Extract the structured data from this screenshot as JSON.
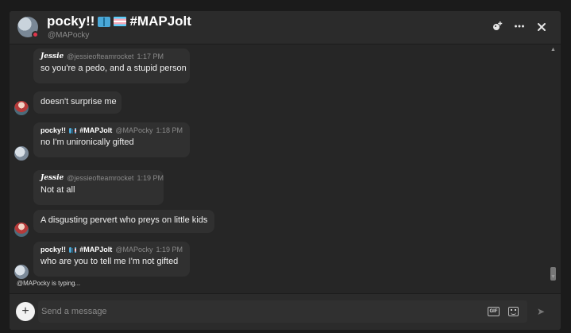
{
  "header": {
    "name": "pocky!!",
    "hashtag": "#MAPJolt",
    "handle": "@MAPocky",
    "icons": [
      "add-friend-icon",
      "more-options-icon",
      "close-icon"
    ]
  },
  "messages": [
    {
      "author": "Jessie",
      "handle": "@jessieofteamrocket",
      "time": "1:17 PM",
      "text": "so you're a pedo, and a stupid person",
      "avatar": "avatar-jessie"
    },
    {
      "author": "",
      "handle": "",
      "time": "",
      "text": "doesn't surprise me",
      "avatar": "avatar-jessie"
    },
    {
      "author": "pocky!!",
      "hashtag": "#MAPJolt",
      "handle": "@MAPocky",
      "time": "1:18 PM",
      "text": "no I'm unironically gifted",
      "avatar": "avatar-pocky"
    },
    {
      "author": "Jessie",
      "handle": "@jessieofteamrocket",
      "time": "1:19 PM",
      "text": "Not at all",
      "avatar": "avatar-jessie"
    },
    {
      "author": "",
      "handle": "",
      "time": "",
      "text": "A disgusting pervert who preys on little kids",
      "avatar": "avatar-jessie"
    },
    {
      "author": "pocky!!",
      "hashtag": "#MAPJolt",
      "handle": "@MAPocky",
      "time": "1:19 PM",
      "text": "who are you to tell me I'm not gifted",
      "avatar": "avatar-pocky"
    }
  ],
  "typing_indicator": "@MAPocky is typing...",
  "composer": {
    "placeholder": "Send a message",
    "gif_label": "GIF",
    "add_label": "+",
    "send_label": "➤"
  }
}
